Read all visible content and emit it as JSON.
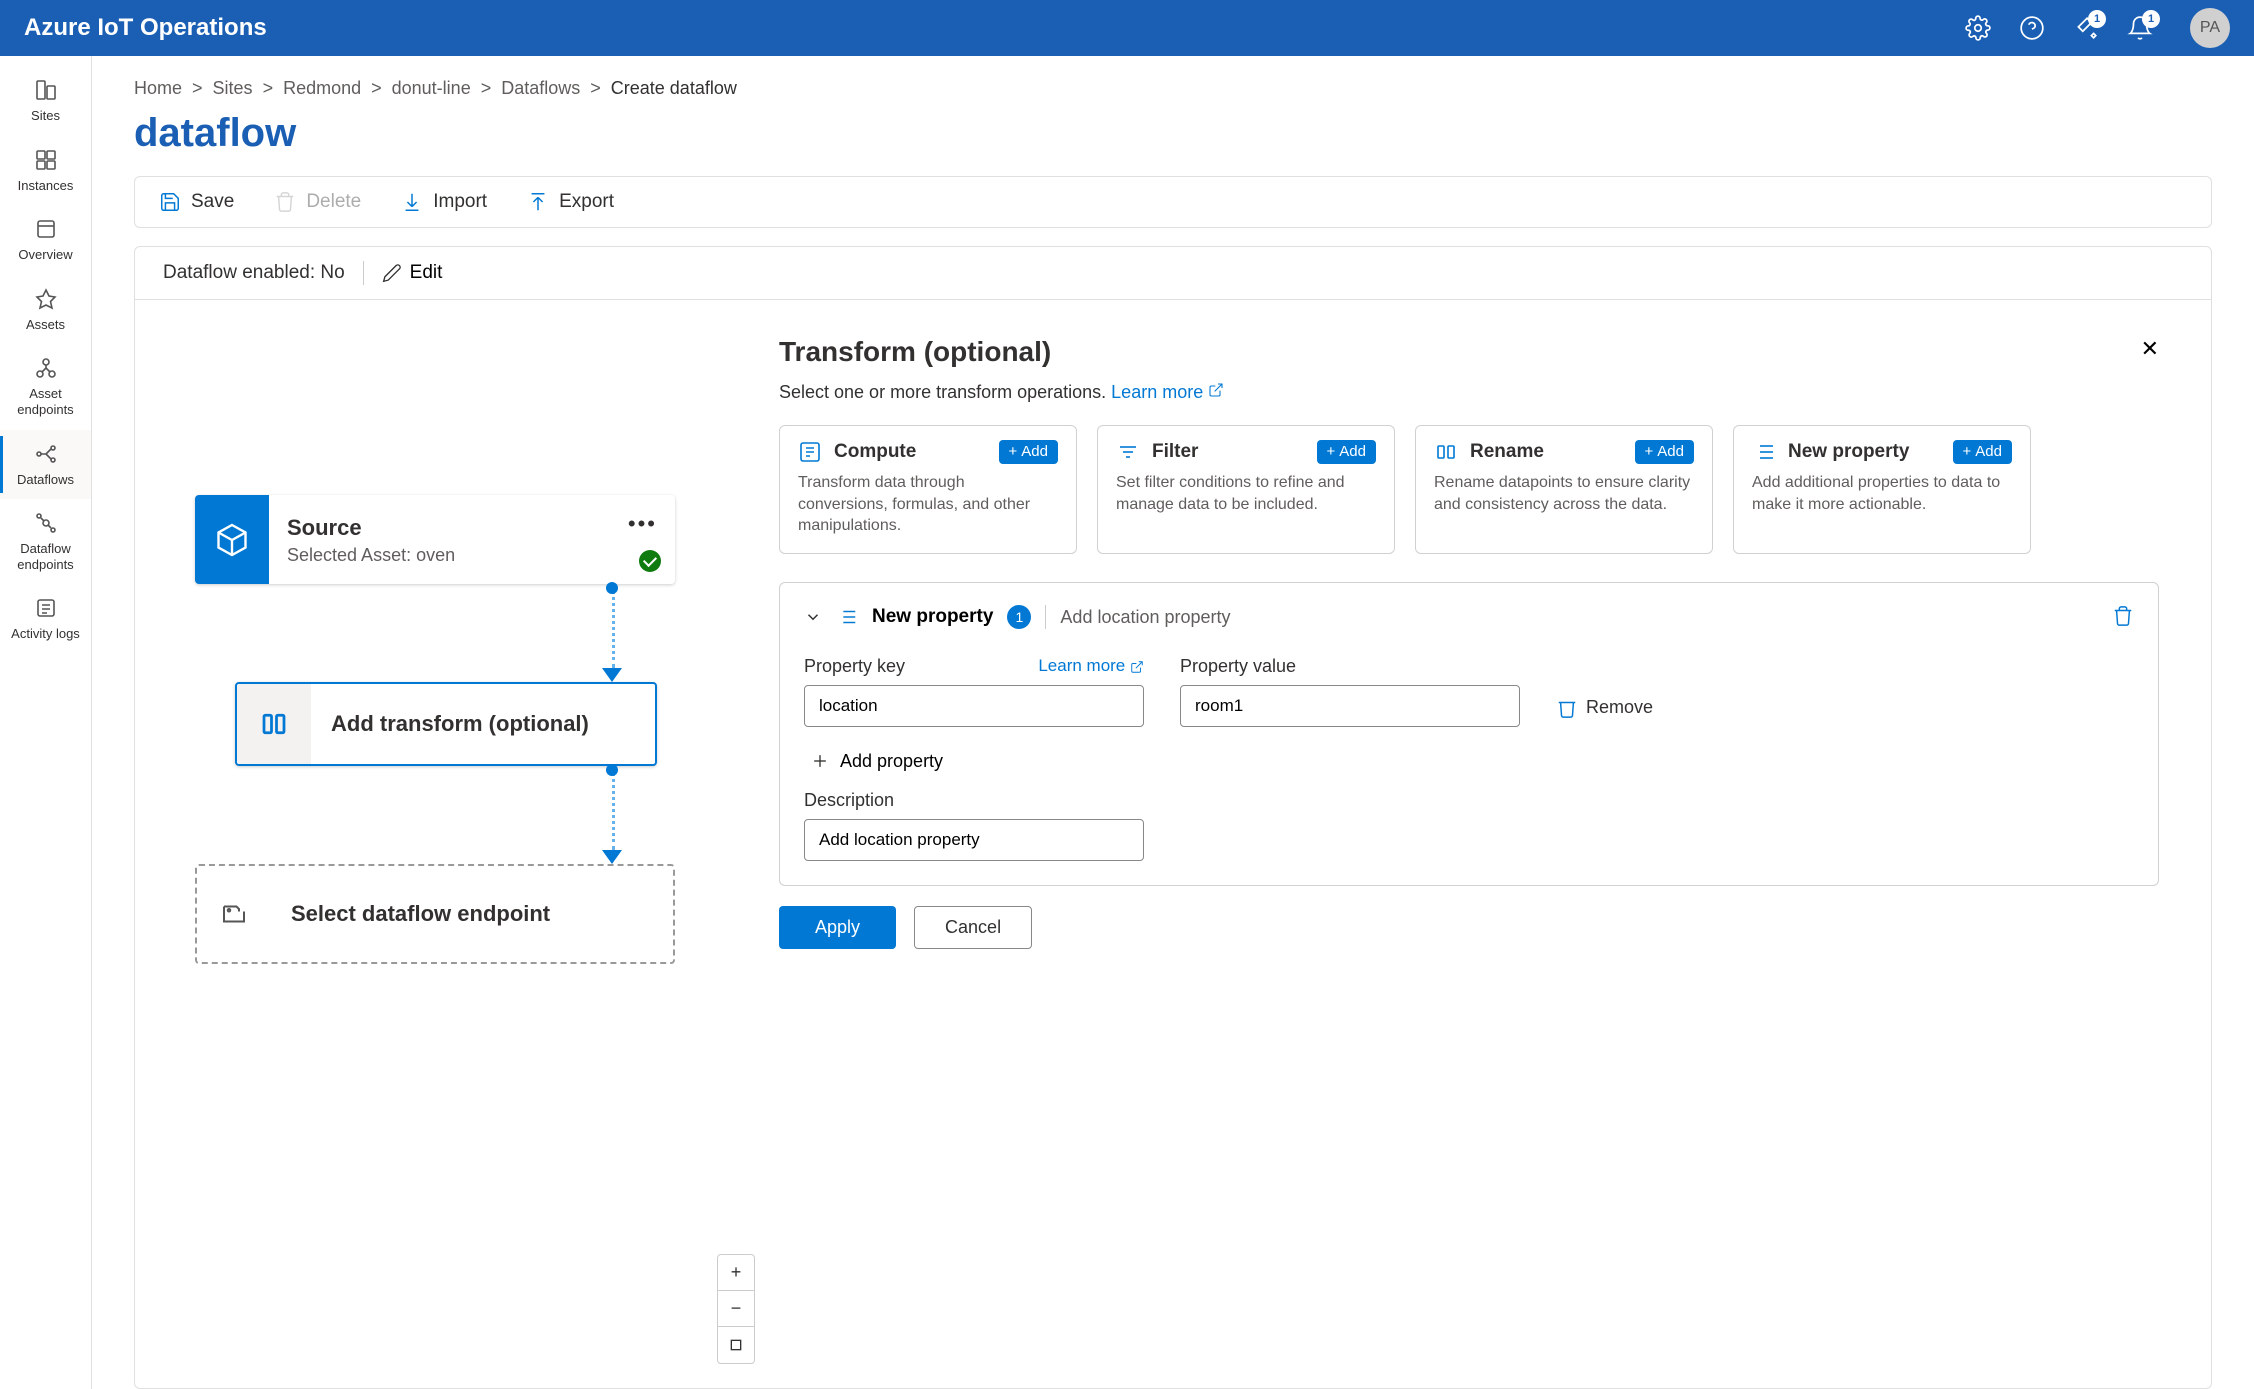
{
  "header": {
    "title": "Azure IoT Operations",
    "badges": {
      "dev": "1",
      "notif": "1"
    },
    "avatar": "PA"
  },
  "sidebar": {
    "items": [
      {
        "label": "Sites"
      },
      {
        "label": "Instances"
      },
      {
        "label": "Overview"
      },
      {
        "label": "Assets"
      },
      {
        "label": "Asset endpoints"
      },
      {
        "label": "Dataflows"
      },
      {
        "label": "Dataflow endpoints"
      },
      {
        "label": "Activity logs"
      }
    ]
  },
  "breadcrumb": [
    "Home",
    "Sites",
    "Redmond",
    "donut-line",
    "Dataflows",
    "Create dataflow"
  ],
  "page_title": "dataflow",
  "toolbar": {
    "save": "Save",
    "delete": "Delete",
    "import": "Import",
    "export": "Export"
  },
  "sub_toolbar": {
    "enabled_label": "Dataflow enabled: No",
    "edit": "Edit"
  },
  "flow": {
    "source": {
      "title": "Source",
      "subtitle": "Selected Asset: oven"
    },
    "transform": {
      "title": "Add transform (optional)"
    },
    "endpoint": {
      "title": "Select dataflow endpoint"
    }
  },
  "right_panel": {
    "title": "Transform (optional)",
    "subtitle": "Select one or more transform operations.",
    "learn_more": "Learn more",
    "cards": {
      "compute": {
        "name": "Compute",
        "desc": "Transform data through conversions, formulas, and other manipulations.",
        "add": "Add"
      },
      "filter": {
        "name": "Filter",
        "desc": "Set filter conditions to refine and manage data to be included.",
        "add": "Add"
      },
      "rename": {
        "name": "Rename",
        "desc": "Rename datapoints to ensure clarity and consistency across the data.",
        "add": "Add"
      },
      "newprop": {
        "name": "New property",
        "desc": "Add additional properties to data to make it more actionable.",
        "add": "Add"
      }
    },
    "rule": {
      "name": "New property",
      "count": "1",
      "summary": "Add location property",
      "prop_key_label": "Property key",
      "prop_val_label": "Property value",
      "learn_more": "Learn more",
      "key_value": "location",
      "val_value": "room1",
      "remove": "Remove",
      "add_property": "Add property",
      "description_label": "Description",
      "description_value": "Add location property"
    },
    "footer": {
      "apply": "Apply",
      "cancel": "Cancel"
    }
  }
}
